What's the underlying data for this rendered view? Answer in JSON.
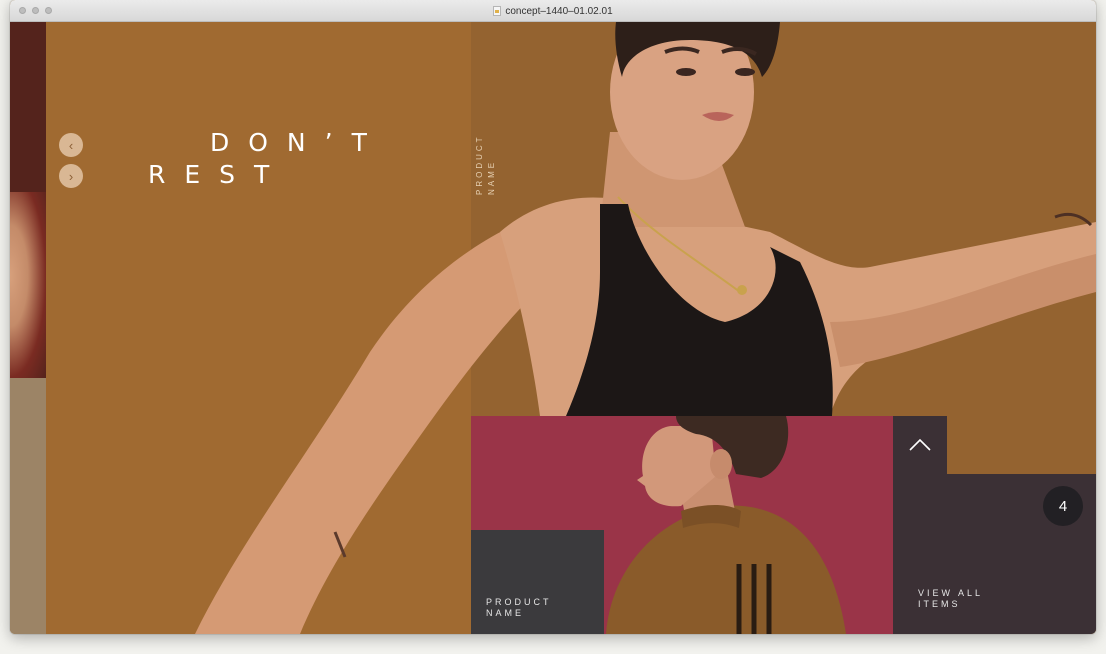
{
  "window": {
    "title": "concept–1440–01.02.01"
  },
  "hero": {
    "headline_line1": "DON’T",
    "headline_line2": "REST",
    "prev_icon": "chevron-left-icon",
    "next_icon": "chevron-right-icon",
    "prev_glyph": "‹",
    "next_glyph": "›"
  },
  "product_vertical": {
    "line1": "PRODUCT",
    "line2": "NAME"
  },
  "product_card": {
    "line1": "PRODUCT",
    "line2": "NAME"
  },
  "view_all": {
    "line1": "VIEW ALL",
    "line2": "ITEMS",
    "count": "4",
    "up_icon": "chevron-up-icon"
  },
  "colors": {
    "mustard": "#a06a31",
    "crimson": "#9a3448",
    "charcoal": "#3b3a3d",
    "plum": "#3b3035"
  }
}
